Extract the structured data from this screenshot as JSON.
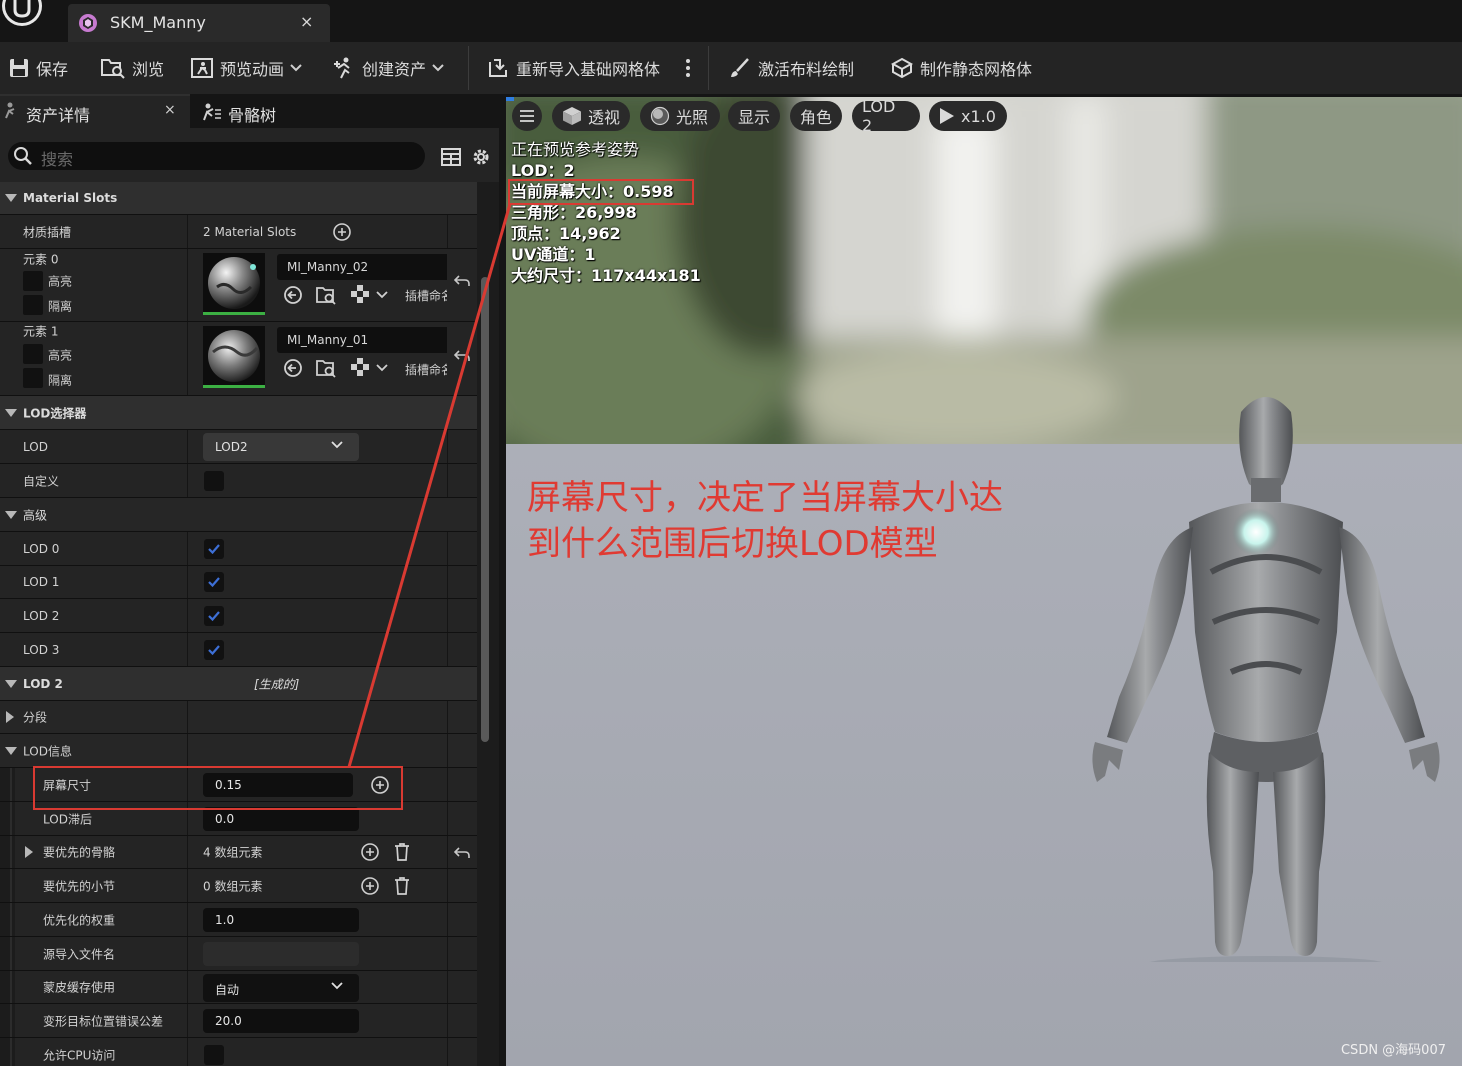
{
  "tab": {
    "title": "SKM_Manny",
    "close": "×"
  },
  "toolbar": {
    "save": "保存",
    "browse": "浏览",
    "preview_anim": "预览动画",
    "create_asset": "创建资产",
    "reimport": "重新导入基础网格体",
    "activate_cloth": "激活布料绘制",
    "make_static": "制作静态网格体"
  },
  "panel": {
    "tab_details": "资产详情",
    "tab_close": "×",
    "tab_skeleton": "骨骼树",
    "search_placeholder": "搜索"
  },
  "material_slots": {
    "header": "Material Slots",
    "label": "材质插槽",
    "value": "2 Material Slots",
    "elements": [
      {
        "label": "元素 0",
        "highlight": "高亮",
        "isolate": "隔离",
        "material": "MI_Manny_02",
        "slot_name": "插槽命名"
      },
      {
        "label": "元素 1",
        "highlight": "高亮",
        "isolate": "隔离",
        "material": "MI_Manny_01",
        "slot_name": "插槽命名"
      }
    ]
  },
  "lod_picker": {
    "header": "LOD选择器",
    "lod_label": "LOD",
    "lod_value": "LOD2",
    "custom_label": "自定义",
    "advanced_label": "高级",
    "lods": [
      "LOD 0",
      "LOD 1",
      "LOD 2",
      "LOD 3"
    ]
  },
  "lod2": {
    "header": "LOD 2",
    "generated": "[生成的]",
    "sections_label": "分段",
    "info_label": "LOD信息",
    "screen_size_label": "屏幕尺寸",
    "screen_size_value": "0.15",
    "hysteresis_label": "LOD滞后",
    "hysteresis_value": "0.0",
    "prioritized_bones_label": "要优先的骨骼",
    "prioritized_bones_value": "4 数组元素",
    "prioritized_sections_label": "要优先的小节",
    "prioritized_sections_value": "0 数组元素",
    "weight_label": "优先化的权重",
    "weight_value": "1.0",
    "source_file_label": "源导入文件名",
    "source_file_value": "",
    "skin_cache_label": "蒙皮缓存使用",
    "skin_cache_value": "自动",
    "morph_tolerance_label": "变形目标位置错误公差",
    "morph_tolerance_value": "20.0",
    "cpu_access_label": "允许CPU访问"
  },
  "viewport": {
    "btn_perspective": "透视",
    "btn_lighting": "光照",
    "btn_show": "显示",
    "btn_character": "角色",
    "btn_lod": "LOD 2",
    "btn_speed": "x1.0",
    "stats": {
      "line1": "正在预览参考姿势",
      "line2": "LOD：2",
      "line3": "当前屏幕大小：0.598",
      "line4": "三角形：26,998",
      "line5": "顶点：14,962",
      "line6": "UV通道：1",
      "line7": "大约尺寸：117x44x181"
    },
    "annotation_line1": "屏幕尺寸，决定了当屏幕大小达",
    "annotation_line2": "到什么范围后切换LOD模型",
    "watermark": "CSDN @海码007"
  },
  "colors": {
    "annotation_red": "#d93a32",
    "check_blue": "#3d6fd6",
    "accent_green": "#3cb043"
  }
}
